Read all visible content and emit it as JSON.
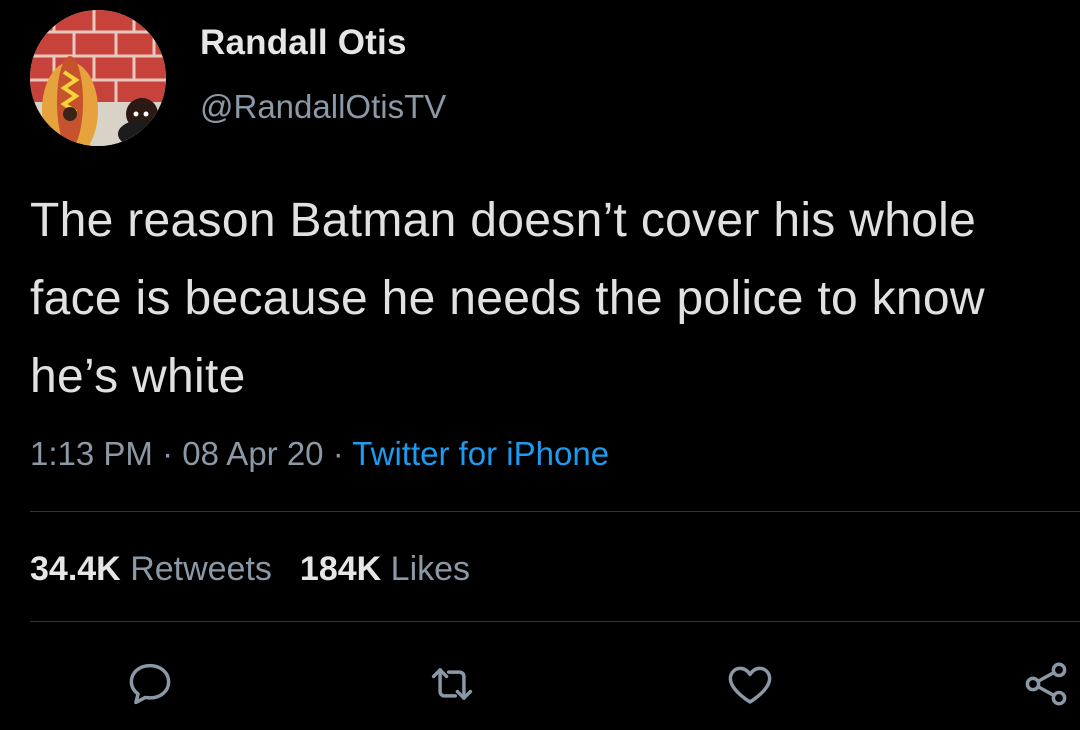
{
  "tweet": {
    "author": {
      "display_name": "Randall Otis",
      "handle": "@RandallOtisTV",
      "avatar": "hotdog-costume-photo"
    },
    "text": "The reason Batman doesn’t cover his whole face is because he needs the police to know he’s white",
    "time": "1:13 PM",
    "date": "08 Apr 20",
    "separator": "·",
    "source": "Twitter for iPhone",
    "stats": {
      "retweets_count": "34.4K",
      "retweets_label": "Retweets",
      "likes_count": "184K",
      "likes_label": "Likes"
    },
    "actions": [
      {
        "name": "reply",
        "icon": "reply-icon"
      },
      {
        "name": "retweet",
        "icon": "retweet-icon"
      },
      {
        "name": "like",
        "icon": "heart-icon"
      },
      {
        "name": "share",
        "icon": "share-icon"
      }
    ]
  },
  "colors": {
    "background": "#000000",
    "text": "#e1e1e1",
    "secondary": "#8b98a5",
    "link": "#1d9bf0",
    "divider": "#2f3336"
  }
}
